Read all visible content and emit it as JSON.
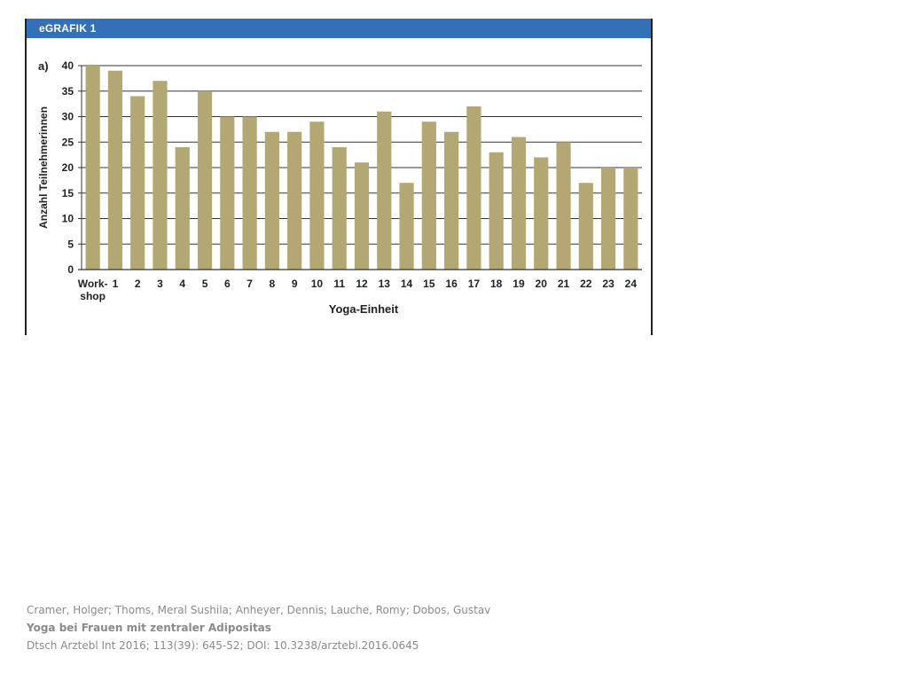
{
  "figure": {
    "title": "eGRAFIK 1",
    "panel_label": "a)",
    "colors": {
      "header": "#3470b7",
      "bar": "#b3a774",
      "grid": "#333333"
    }
  },
  "chart_data": {
    "type": "bar",
    "categories": [
      "Work-\nshop",
      "1",
      "2",
      "3",
      "4",
      "5",
      "6",
      "7",
      "8",
      "9",
      "10",
      "11",
      "12",
      "13",
      "14",
      "15",
      "16",
      "17",
      "18",
      "19",
      "20",
      "21",
      "22",
      "23",
      "24"
    ],
    "values": [
      40,
      39,
      34,
      37,
      24,
      35,
      30,
      30,
      27,
      27,
      29,
      24,
      21,
      31,
      17,
      29,
      27,
      32,
      23,
      26,
      22,
      25,
      17,
      20,
      20
    ],
    "xlabel": "Yoga-Einheit",
    "ylabel": "Anzahl Teilnehmerinnen",
    "ylim": [
      0,
      40
    ],
    "yticks": [
      0,
      5,
      10,
      15,
      20,
      25,
      30,
      35,
      40
    ],
    "grid": true
  },
  "citation": {
    "authors": "Cramer, Holger; Thoms, Meral Sushila; Anheyer, Dennis; Lauche, Romy; Dobos, Gustav",
    "title": "Yoga bei Frauen mit zentraler Adipositas",
    "source": "Dtsch Arztebl Int 2016; 113(39): 645-52; DOI: 10.3238/arztebl.2016.0645"
  }
}
